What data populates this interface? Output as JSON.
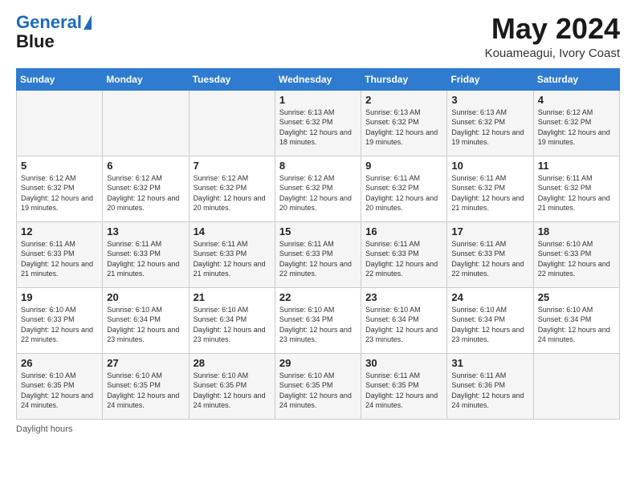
{
  "header": {
    "logo_line1": "General",
    "logo_line2": "Blue",
    "month_title": "May 2024",
    "location": "Kouameagui, Ivory Coast"
  },
  "footer": {
    "daylight_label": "Daylight hours"
  },
  "weekdays": [
    "Sunday",
    "Monday",
    "Tuesday",
    "Wednesday",
    "Thursday",
    "Friday",
    "Saturday"
  ],
  "weeks": [
    [
      {
        "day": "",
        "detail": ""
      },
      {
        "day": "",
        "detail": ""
      },
      {
        "day": "",
        "detail": ""
      },
      {
        "day": "1",
        "detail": "Sunrise: 6:13 AM\nSunset: 6:32 PM\nDaylight: 12 hours\nand 18 minutes."
      },
      {
        "day": "2",
        "detail": "Sunrise: 6:13 AM\nSunset: 6:32 PM\nDaylight: 12 hours\nand 19 minutes."
      },
      {
        "day": "3",
        "detail": "Sunrise: 6:13 AM\nSunset: 6:32 PM\nDaylight: 12 hours\nand 19 minutes."
      },
      {
        "day": "4",
        "detail": "Sunrise: 6:12 AM\nSunset: 6:32 PM\nDaylight: 12 hours\nand 19 minutes."
      }
    ],
    [
      {
        "day": "5",
        "detail": "Sunrise: 6:12 AM\nSunset: 6:32 PM\nDaylight: 12 hours\nand 19 minutes."
      },
      {
        "day": "6",
        "detail": "Sunrise: 6:12 AM\nSunset: 6:32 PM\nDaylight: 12 hours\nand 20 minutes."
      },
      {
        "day": "7",
        "detail": "Sunrise: 6:12 AM\nSunset: 6:32 PM\nDaylight: 12 hours\nand 20 minutes."
      },
      {
        "day": "8",
        "detail": "Sunrise: 6:12 AM\nSunset: 6:32 PM\nDaylight: 12 hours\nand 20 minutes."
      },
      {
        "day": "9",
        "detail": "Sunrise: 6:11 AM\nSunset: 6:32 PM\nDaylight: 12 hours\nand 20 minutes."
      },
      {
        "day": "10",
        "detail": "Sunrise: 6:11 AM\nSunset: 6:32 PM\nDaylight: 12 hours\nand 21 minutes."
      },
      {
        "day": "11",
        "detail": "Sunrise: 6:11 AM\nSunset: 6:32 PM\nDaylight: 12 hours\nand 21 minutes."
      }
    ],
    [
      {
        "day": "12",
        "detail": "Sunrise: 6:11 AM\nSunset: 6:33 PM\nDaylight: 12 hours\nand 21 minutes."
      },
      {
        "day": "13",
        "detail": "Sunrise: 6:11 AM\nSunset: 6:33 PM\nDaylight: 12 hours\nand 21 minutes."
      },
      {
        "day": "14",
        "detail": "Sunrise: 6:11 AM\nSunset: 6:33 PM\nDaylight: 12 hours\nand 21 minutes."
      },
      {
        "day": "15",
        "detail": "Sunrise: 6:11 AM\nSunset: 6:33 PM\nDaylight: 12 hours\nand 22 minutes."
      },
      {
        "day": "16",
        "detail": "Sunrise: 6:11 AM\nSunset: 6:33 PM\nDaylight: 12 hours\nand 22 minutes."
      },
      {
        "day": "17",
        "detail": "Sunrise: 6:11 AM\nSunset: 6:33 PM\nDaylight: 12 hours\nand 22 minutes."
      },
      {
        "day": "18",
        "detail": "Sunrise: 6:10 AM\nSunset: 6:33 PM\nDaylight: 12 hours\nand 22 minutes."
      }
    ],
    [
      {
        "day": "19",
        "detail": "Sunrise: 6:10 AM\nSunset: 6:33 PM\nDaylight: 12 hours\nand 22 minutes."
      },
      {
        "day": "20",
        "detail": "Sunrise: 6:10 AM\nSunset: 6:34 PM\nDaylight: 12 hours\nand 23 minutes."
      },
      {
        "day": "21",
        "detail": "Sunrise: 6:10 AM\nSunset: 6:34 PM\nDaylight: 12 hours\nand 23 minutes."
      },
      {
        "day": "22",
        "detail": "Sunrise: 6:10 AM\nSunset: 6:34 PM\nDaylight: 12 hours\nand 23 minutes."
      },
      {
        "day": "23",
        "detail": "Sunrise: 6:10 AM\nSunset: 6:34 PM\nDaylight: 12 hours\nand 23 minutes."
      },
      {
        "day": "24",
        "detail": "Sunrise: 6:10 AM\nSunset: 6:34 PM\nDaylight: 12 hours\nand 23 minutes."
      },
      {
        "day": "25",
        "detail": "Sunrise: 6:10 AM\nSunset: 6:34 PM\nDaylight: 12 hours\nand 24 minutes."
      }
    ],
    [
      {
        "day": "26",
        "detail": "Sunrise: 6:10 AM\nSunset: 6:35 PM\nDaylight: 12 hours\nand 24 minutes."
      },
      {
        "day": "27",
        "detail": "Sunrise: 6:10 AM\nSunset: 6:35 PM\nDaylight: 12 hours\nand 24 minutes."
      },
      {
        "day": "28",
        "detail": "Sunrise: 6:10 AM\nSunset: 6:35 PM\nDaylight: 12 hours\nand 24 minutes."
      },
      {
        "day": "29",
        "detail": "Sunrise: 6:10 AM\nSunset: 6:35 PM\nDaylight: 12 hours\nand 24 minutes."
      },
      {
        "day": "30",
        "detail": "Sunrise: 6:11 AM\nSunset: 6:35 PM\nDaylight: 12 hours\nand 24 minutes."
      },
      {
        "day": "31",
        "detail": "Sunrise: 6:11 AM\nSunset: 6:36 PM\nDaylight: 12 hours\nand 24 minutes."
      },
      {
        "day": "",
        "detail": ""
      }
    ]
  ]
}
